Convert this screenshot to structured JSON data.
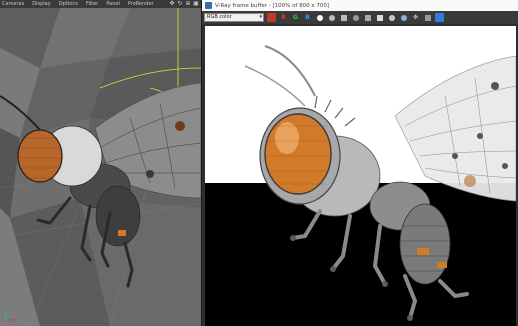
{
  "viewport": {
    "menu": [
      "Cameras",
      "Display",
      "Options",
      "Filter",
      "Panel",
      "ProRender"
    ],
    "icons": [
      "move-icon",
      "rotate-icon",
      "zoom-icon",
      "maximize-icon"
    ]
  },
  "vfb": {
    "title": "V-Ray frame buffer - [100% of 800 x 700]",
    "channel": "RGB color",
    "toolbar": {
      "r": "R",
      "g": "G",
      "b": "B"
    }
  },
  "colors": {
    "viewport_bg": "#6b6b6b",
    "render_top": "#ffffff",
    "render_bottom": "#000000",
    "eye_orange": "#d07a2a",
    "selection_yellow": "#d9e03a"
  }
}
